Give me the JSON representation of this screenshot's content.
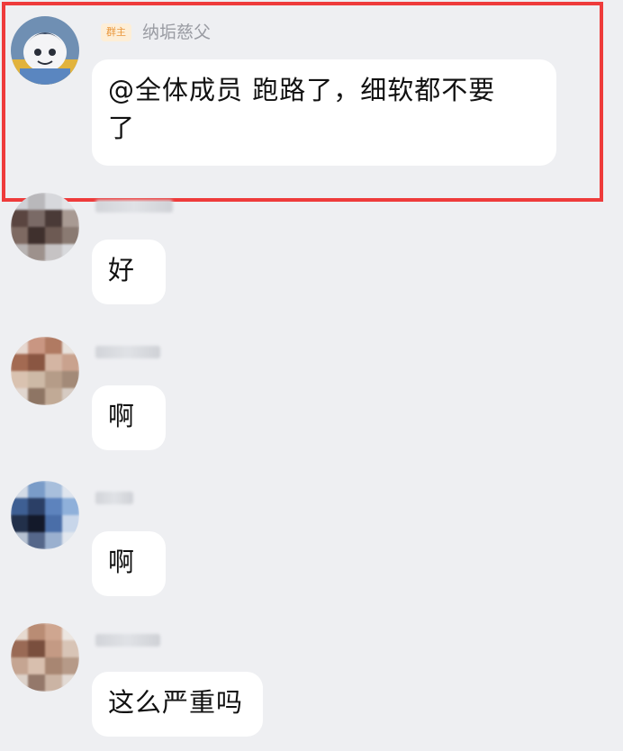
{
  "messages": [
    {
      "badge": "群主",
      "sender": "纳垢慈父",
      "text": "@全体成员 跑路了，细软都不要了",
      "line1": "@全体成员 跑路了，细软都不要",
      "line2": "了",
      "highlighted": true
    },
    {
      "sender_blurred": true,
      "text": "好"
    },
    {
      "sender_blurred": true,
      "text": "啊"
    },
    {
      "sender_blurred": true,
      "text": "啊"
    },
    {
      "sender_blurred": true,
      "text": "这么严重吗"
    }
  ],
  "colors": {
    "background": "#eeeff2",
    "bubble": "#ffffff",
    "highlight": "#ee3b3b",
    "badge_bg": "#fdeed7",
    "badge_text": "#e9963a",
    "sender_text": "#9a9ca3"
  },
  "icons": {
    "owner_avatar": "cartoon-avatar-icon",
    "member_avatar": "pixelated-avatar"
  }
}
